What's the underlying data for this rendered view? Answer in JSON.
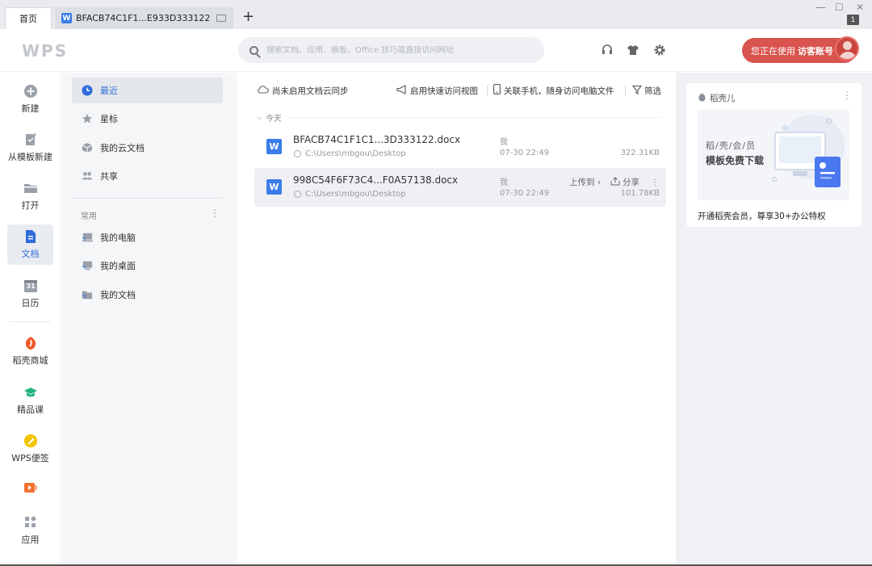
{
  "titlebar": {
    "home_tab": "首页",
    "doc_tab": "BFACB74C1F1...E933D333122",
    "add_tab": "+",
    "win_min": "—",
    "win_max": "☐",
    "win_close": "✕",
    "badge": "1"
  },
  "header": {
    "logo": "WPS",
    "search_placeholder": "搜索文档、应用、模板、Office 技巧或直接访问网址",
    "guest_prefix": "您正在使用",
    "guest_label": "访客账号"
  },
  "leftnav": {
    "items": [
      {
        "label": "新建",
        "icon": "plus-circle-icon"
      },
      {
        "label": "从模板新建",
        "icon": "template-icon"
      },
      {
        "label": "打开",
        "icon": "folder-icon"
      },
      {
        "label": "文档",
        "icon": "document-icon"
      },
      {
        "label": "日历",
        "icon": "calendar-icon"
      },
      {
        "label": "稻壳商城",
        "icon": "daoke-icon"
      },
      {
        "label": "精品课",
        "icon": "graduation-cap-icon"
      },
      {
        "label": "WPS便签",
        "icon": "pen-note-icon"
      },
      {
        "label": "",
        "icon": "video-icon"
      },
      {
        "label": "应用",
        "icon": "apps-grid-icon"
      }
    ],
    "calendar_number": "31"
  },
  "subnav": {
    "recent": "最近",
    "starred": "星标",
    "cloud": "我的云文档",
    "shared": "共享",
    "section_common": "常用",
    "my_computer": "我的电脑",
    "my_desktop": "我的桌面",
    "my_documents": "我的文档"
  },
  "main": {
    "cloud_sync": "尚未启用文档云同步",
    "quick_view": "启用快速访问视图",
    "link_phone": "关联手机，随身访问电脑文件",
    "filter": "筛选",
    "today": "今天",
    "files": [
      {
        "name": "BFACB74C1F1C1...3D333122.docx",
        "path": "C:\\Users\\mbgou\\Desktop",
        "owner": "我",
        "time": "07-30 22:49",
        "size": "322.31KB"
      },
      {
        "name": "998C54F6F73C4...F0A57138.docx",
        "path": "C:\\Users\\mbgou\\Desktop",
        "owner": "我",
        "time": "07-30 22:49",
        "size": "101.78KB",
        "upload": "上传到 ›",
        "share": "分享"
      }
    ]
  },
  "rightpanel": {
    "title": "稻壳儿",
    "banner_sub": "稻/壳/会/员",
    "banner_head": "模板免费下载",
    "promo_text": "开通稻壳会员，尊享30+办公特权"
  },
  "colors": {
    "accent": "#2f6cdc",
    "word_blue": "#3b7ce9",
    "guest_red": "#d9534f"
  }
}
